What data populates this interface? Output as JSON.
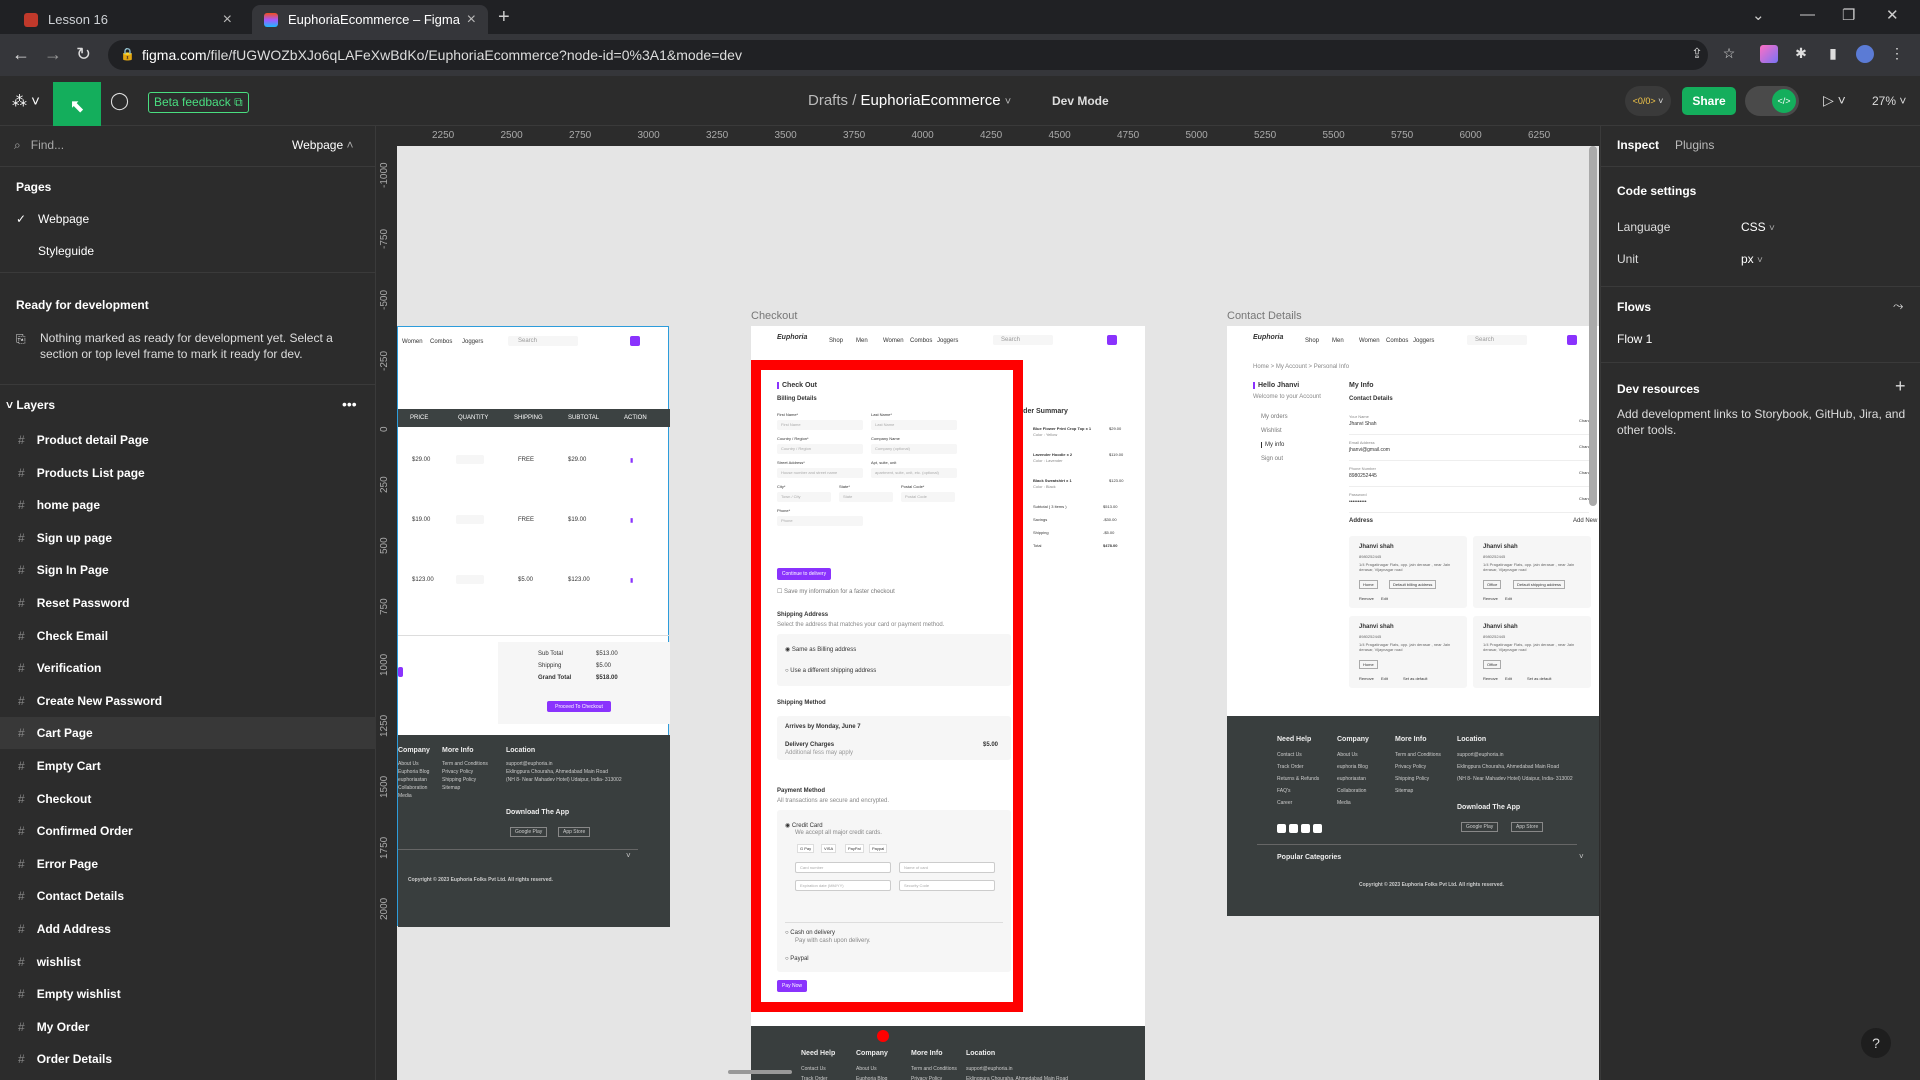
{
  "browser": {
    "tabs": [
      {
        "label": "Lesson 16",
        "active": false
      },
      {
        "label": "EuphoriaEcommerce – Figma",
        "active": true
      }
    ],
    "url_host": "figma.com",
    "url_path": "/file/fUGWOZbXJo6qLAFeXwBdKo/EuphoriaEcommerce?node-id=0%3A1&mode=dev"
  },
  "toolbar": {
    "beta_label": "Beta feedback",
    "breadcrumb_root": "Drafts",
    "breadcrumb_sep": "/",
    "file_name": "EuphoriaEcommerce",
    "mode_label": "Dev Mode",
    "share_label": "Share",
    "code_badge": "<0/0>",
    "zoom": "27%"
  },
  "left": {
    "find_placeholder": "Find...",
    "page_selector": "Webpage",
    "pages_header": "Pages",
    "pages": [
      "Webpage",
      "Styleguide"
    ],
    "ready_header": "Ready for development",
    "ready_notice": "Nothing marked as ready for development yet. Select a section or top level frame to mark it ready for dev.",
    "layers_header": "Layers",
    "layers": [
      "Product detail Page",
      "Products List page",
      "home page",
      "Sign up page",
      "Sign In Page",
      "Reset Password",
      "Check Email",
      "Verification",
      "Create New Password",
      "Cart Page",
      "Empty Cart",
      "Checkout",
      "Confirmed Order",
      "Error Page",
      "Contact Details",
      "Add Address",
      "wishlist",
      "Empty wishlist",
      "My Order",
      "Order Details"
    ],
    "selected_layer": "Cart Page"
  },
  "ruler": {
    "top": [
      "2250",
      "2500",
      "2750",
      "3000",
      "3250",
      "3500",
      "3750",
      "4000",
      "4250",
      "4500",
      "4750",
      "5000",
      "5250",
      "5500",
      "5750",
      "6000",
      "6250"
    ],
    "left": [
      "-1000",
      "-750",
      "-500",
      "-250",
      "0",
      "250",
      "500",
      "750",
      "1000",
      "1250",
      "1500",
      "1750",
      "2000"
    ]
  },
  "canvas": {
    "cart": {
      "nav": [
        "Women",
        "Combos",
        "Joggers"
      ],
      "search": "Search",
      "columns": [
        "PRICE",
        "QUANTITY",
        "SHIPPING",
        "SUBTOTAL",
        "ACTION"
      ],
      "rows": [
        {
          "price": "$29.00",
          "ship": "FREE",
          "sub": "$29.00"
        },
        {
          "price": "$19.00",
          "ship": "FREE",
          "sub": "$19.00"
        },
        {
          "price": "$123.00",
          "ship": "$5.00",
          "sub": "$123.00"
        }
      ],
      "totals": [
        {
          "label": "Sub Total",
          "value": "$513.00"
        },
        {
          "label": "Shipping",
          "value": "$5.00"
        },
        {
          "label": "Grand Total",
          "value": "$518.00"
        }
      ],
      "proceed": "Proceed To Checkout",
      "footer_heads": [
        "Company",
        "More Info",
        "Location"
      ],
      "footer_company": [
        "About Us",
        "Euphoria Blog",
        "euphoriastan",
        "Collaboration",
        "Media"
      ],
      "footer_more": [
        "Term and Conditions",
        "Privacy Policy",
        "Shipping Policy",
        "Sitemap"
      ],
      "footer_loc": [
        "support@euphoria.in",
        "Eklingpura Chouraha, Ahmedabad Main Road",
        "(NH 8- Near Mahadev Hotel) Udaipur, India- 313002"
      ],
      "download": "Download The App",
      "stores": [
        "Google Play",
        "App Store"
      ],
      "copyright": "Copyright © 2023 Euphoria Folks Pvt Ltd. All rights reserved."
    },
    "checkout": {
      "label": "Checkout",
      "logo": "Euphoria",
      "nav": [
        "Shop",
        "Men",
        "Women",
        "Combos",
        "Joggers"
      ],
      "search": "Search",
      "title": "Check Out",
      "billing": "Billing Details",
      "fields": [
        "First Name*",
        "Last Name*",
        "Country / Region*",
        "Company Name",
        "Street Address*",
        "Apt, suite, unit",
        "City*",
        "State*",
        "Postal Code*",
        "Phone*"
      ],
      "placeholders": [
        "First Name",
        "Last Name",
        "Country / Region",
        "Company (optional)",
        "House number and street name",
        "apartment, suite, unit, etc. (optional)",
        "Town / City",
        "State",
        "Postal Code",
        "Phone"
      ],
      "continue": "Continue to delivery",
      "save_info": "Save my information for a faster checkout",
      "ship_addr": "Shipping Address",
      "ship_addr_sub": "Select the address that matches your card or payment method.",
      "same_billing": "Same as Billing address",
      "diff_ship": "Use a different shipping address",
      "ship_method": "Shipping Method",
      "arrives": "Arrives by Monday, June 7",
      "delivery": "Delivery Charges",
      "delivery_sub": "Additional fess may apply",
      "delivery_val": "$5.00",
      "payment": "Payment Method",
      "payment_sub": "All transactions are secure and encrypted.",
      "credit": "Credit Card",
      "credit_sub": "We accept all major credit cards.",
      "cards": [
        "G Pay",
        "VISA",
        "PayPal",
        "Paypal"
      ],
      "card_fields": [
        "Card number",
        "Name of card",
        "Expiration date (MM/YY)",
        "Security Code"
      ],
      "cod": "Cash on delivery",
      "cod_sub": "Pay with cash upon delivery.",
      "paypal": "Paypal",
      "paynow": "Pay Now",
      "summary": "Order Summary",
      "summary_items": [
        {
          "name": "Blue Flower Print Crop Top x 1",
          "sub": "Color : Yellow",
          "price": "$29.00"
        },
        {
          "name": "Lavender Hoodie x 2",
          "sub": "Color : Lavender",
          "price": "$119.00"
        },
        {
          "name": "Black Sweatshirt x 1",
          "sub": "Color : Black",
          "price": "$123.00"
        }
      ],
      "summary_totals": [
        {
          "label": "Subtotal ( 3 items )",
          "value": "$513.00"
        },
        {
          "label": "Savings",
          "value": "-$30.00"
        },
        {
          "label": "Shipping",
          "value": "-$5.00"
        },
        {
          "label": "Total",
          "value": "$478.00"
        }
      ],
      "foot_heads": [
        "Need Help",
        "Company",
        "More Info",
        "Location"
      ],
      "foot_row1": [
        "Contact Us",
        "About Us",
        "Term and Conditions",
        "support@euphoria.in"
      ],
      "foot_row2": [
        "Track Order",
        "Euphoria Blog",
        "Privacy Policy",
        "Eklingpura Chouraha, Ahmedabad Main Road"
      ]
    },
    "contact": {
      "label": "Contact Details",
      "logo": "Euphoria",
      "nav": [
        "Shop",
        "Men",
        "Women",
        "Combos",
        "Joggers"
      ],
      "search": "Search",
      "crumbs": "Home  >  My Account  >  Personal Info",
      "hello": "Hello Jhanvi",
      "welcome": "Welcome to your Account",
      "menu": [
        "My orders",
        "Wishlist",
        "My info",
        "Sign out"
      ],
      "myinfo": "My Info",
      "contact_details": "Contact Details",
      "fields": [
        {
          "label": "Your Name",
          "value": "Jhanvi Shah"
        },
        {
          "label": "Email Address",
          "value": "jhanvi@gmail.com"
        },
        {
          "label": "Phone Number",
          "value": "8980252445"
        },
        {
          "label": "Password",
          "value": "••••••••••"
        }
      ],
      "change": "Change",
      "address": "Address",
      "add_new": "Add New",
      "addr_name": "Jhanvi shah",
      "addr_phone": "8980252445",
      "addr_text": "1/4 Pragatinagar Flats, opp. jain derasar , near Jain derasar, Vijaynagar road",
      "tags": [
        "Home",
        "Default billing address",
        "Office",
        "Default shipping address"
      ],
      "actions": [
        "Remove",
        "Edit",
        "Set as default"
      ],
      "foot_heads": [
        "Need Help",
        "Company",
        "More Info",
        "Location"
      ],
      "foot_help": [
        "Contact Us",
        "Track Order",
        "Returns & Refunds",
        "FAQ's",
        "Career"
      ],
      "foot_company": [
        "About Us",
        "euphoria Blog",
        "euphoriastan",
        "Collaboration",
        "Media"
      ],
      "foot_more": [
        "Term and Conditions",
        "Privacy Policy",
        "Shipping Policy",
        "Sitemap"
      ],
      "foot_loc": [
        "support@euphoria.in",
        "Eklingpura Chouraha, Ahmedabad Main Road",
        "(NH 8- Near Mahadev Hotel) Udaipur, India- 313002"
      ],
      "download": "Download The App",
      "stores": [
        "Google Play",
        "App Store"
      ],
      "popular": "Popular Categories",
      "copyright": "Copyright © 2023 Euphoria Folks Pvt Ltd. All rights reserved."
    }
  },
  "right": {
    "tabs": [
      "Inspect",
      "Plugins"
    ],
    "code_settings": "Code settings",
    "language_label": "Language",
    "language_value": "CSS",
    "unit_label": "Unit",
    "unit_value": "px",
    "flows": "Flows",
    "flow1": "Flow 1",
    "dev_resources": "Dev resources",
    "dev_resources_text": "Add development links to Storybook, GitHub, Jira, and other tools."
  },
  "colors": {
    "accent": "#14ae5c",
    "brand": "#8a33fd",
    "highlight": "#ff0000",
    "footer": "#393e3e"
  }
}
